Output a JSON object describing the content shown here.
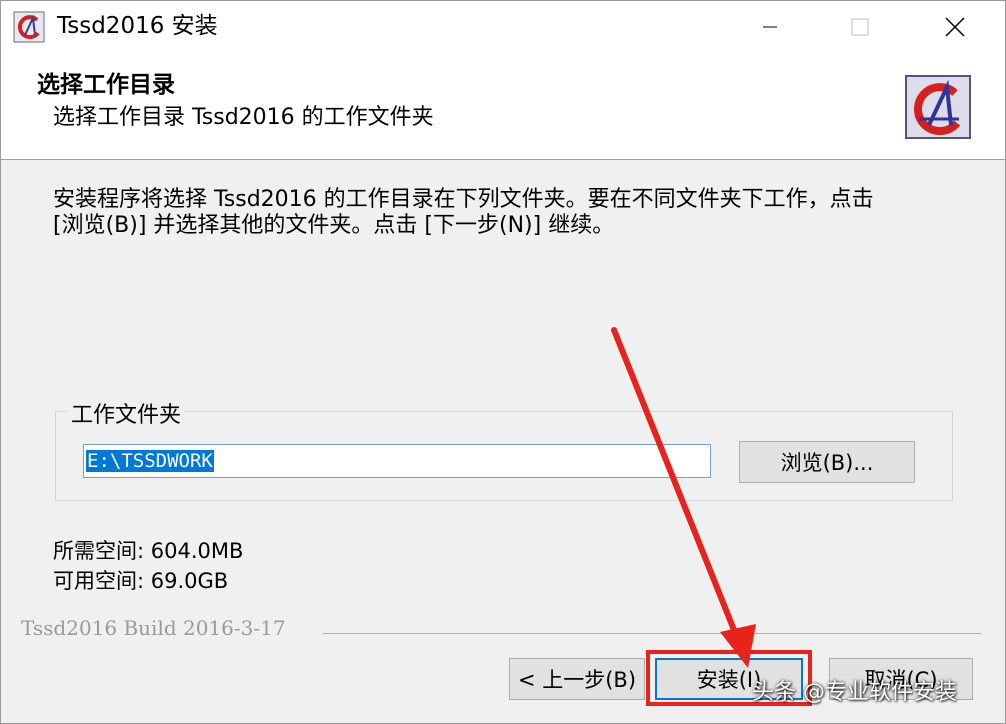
{
  "window": {
    "title": "Tssd2016 安装"
  },
  "header": {
    "title": "选择工作目录",
    "subtitle": "选择工作目录 Tssd2016 的工作文件夹"
  },
  "body": {
    "instructions": "安装程序将选择 Tssd2016 的工作目录在下列文件夹。要在不同文件夹下工作，点击\n[浏览(B)] 并选择其他的文件夹。点击 [下一步(N)] 继续。"
  },
  "folder_group": {
    "label": "工作文件夹",
    "path_value": "E:\\TSSDWORK",
    "browse_label": "浏览(B)..."
  },
  "space": {
    "required": "所需空间: 604.0MB",
    "available": "可用空间: 69.0GB"
  },
  "footer": {
    "build": "Tssd2016 Build 2016-3-17",
    "back_label": "< 上一步(B)",
    "install_label": "安装(I)",
    "cancel_label": "取消(C)"
  },
  "watermark": "头条 @专业软件安装",
  "colors": {
    "accent": "#0078d7",
    "annotation_red": "#e8231c"
  },
  "icons": {
    "app": "tssd-app-icon",
    "logo": "tssd-logo-icon",
    "minimize": "minimize-icon",
    "maximize": "maximize-icon",
    "close": "close-icon"
  }
}
